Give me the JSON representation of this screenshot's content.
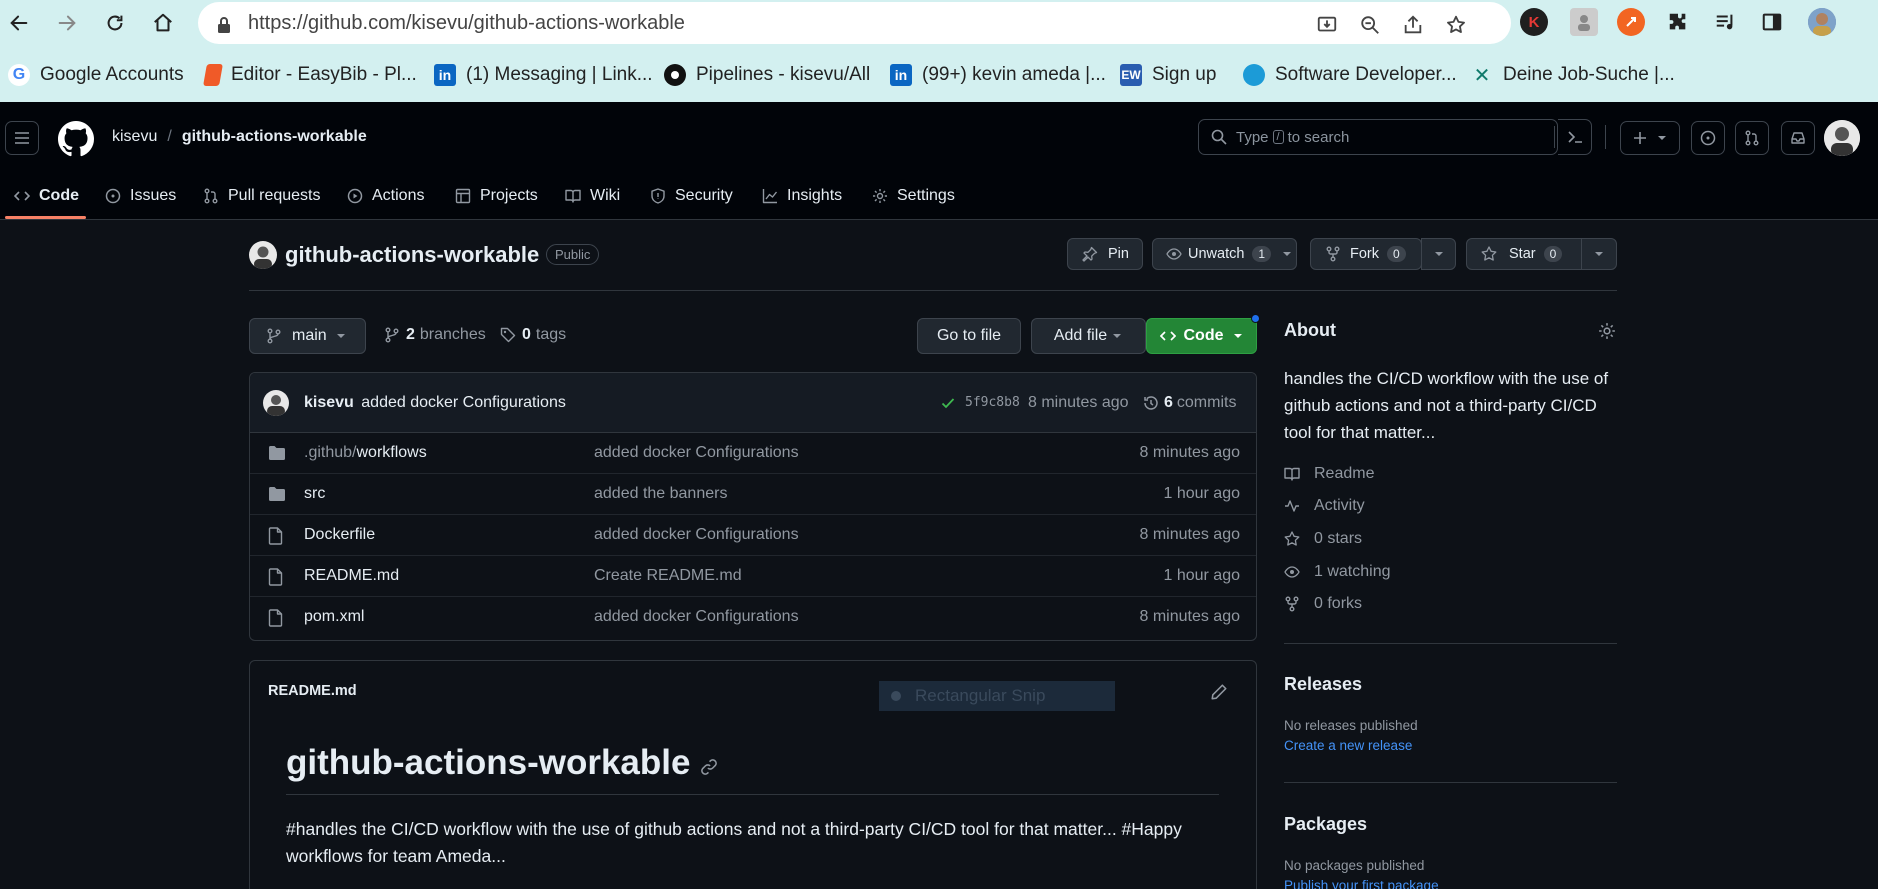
{
  "browser": {
    "url": "https://github.com/kisevu/github-actions-workable",
    "url_host": "https://github.com/",
    "url_path": "kisevu/github-actions-workable",
    "bookmarks": [
      {
        "label": "Google Accounts",
        "icon": "google-icon",
        "color": "#4285f4"
      },
      {
        "label": "Editor - EasyBib - Pl...",
        "icon": "easybib-icon",
        "color": "#f05a28"
      },
      {
        "label": "(1) Messaging | Link...",
        "icon": "linkedin-icon",
        "color": "#0a66c2"
      },
      {
        "label": "Pipelines - kisevu/All",
        "icon": "circleci-icon",
        "color": "#111111"
      },
      {
        "label": "(99+) kevin ameda |...",
        "icon": "linkedin-icon",
        "color": "#0a66c2"
      },
      {
        "label": "Sign up",
        "icon": "ew-icon",
        "color": "#2a5db0"
      },
      {
        "label": "Software Developer...",
        "icon": "globe-icon",
        "color": "#1c9bd7"
      },
      {
        "label": "Deine Job-Suche |...",
        "icon": "xing-icon",
        "color": "#0f7a6b"
      }
    ]
  },
  "header": {
    "owner": "kisevu",
    "separator": "/",
    "repo": "github-actions-workable",
    "search_prefix": "Type",
    "search_key": "/",
    "search_suffix": "to search"
  },
  "tabs": [
    {
      "label": "Code",
      "icon": "code-icon"
    },
    {
      "label": "Issues",
      "icon": "issue-icon"
    },
    {
      "label": "Pull requests",
      "icon": "pull-request-icon"
    },
    {
      "label": "Actions",
      "icon": "play-icon"
    },
    {
      "label": "Projects",
      "icon": "table-icon"
    },
    {
      "label": "Wiki",
      "icon": "book-icon"
    },
    {
      "label": "Security",
      "icon": "shield-icon"
    },
    {
      "label": "Insights",
      "icon": "graph-icon"
    },
    {
      "label": "Settings",
      "icon": "gear-icon"
    }
  ],
  "repo_head": {
    "name": "github-actions-workable",
    "visibility": "Public",
    "pin": "Pin",
    "unwatch": "Unwatch",
    "unwatch_count": "1",
    "fork": "Fork",
    "fork_count": "0",
    "star": "Star",
    "star_count": "0"
  },
  "toolbar": {
    "branch": "main",
    "branches_count": "2",
    "branches_label": "branches",
    "tags_count": "0",
    "tags_label": "tags",
    "go_to_file": "Go to file",
    "add_file": "Add file",
    "code": "Code"
  },
  "latest_commit": {
    "author": "kisevu",
    "message": "added docker Configurations",
    "sha": "5f9c8b8",
    "time": "8 minutes ago",
    "commits_count": "6",
    "commits_label": "commits"
  },
  "files": [
    {
      "type": "folder",
      "prefix": ".github/",
      "name": "workflows",
      "message": "added docker Configurations",
      "time": "8 minutes ago"
    },
    {
      "type": "folder",
      "prefix": "",
      "name": "src",
      "message": "added the banners",
      "time": "1 hour ago"
    },
    {
      "type": "file",
      "prefix": "",
      "name": "Dockerfile",
      "message": "added docker Configurations",
      "time": "8 minutes ago"
    },
    {
      "type": "file",
      "prefix": "",
      "name": "README.md",
      "message": "Create README.md",
      "time": "1 hour ago"
    },
    {
      "type": "file",
      "prefix": "",
      "name": "pom.xml",
      "message": "added docker Configurations",
      "time": "8 minutes ago"
    }
  ],
  "readme": {
    "filename": "README.md",
    "heading": "github-actions-workable",
    "body": "#handles the CI/CD workflow with the use of github actions and not a third-party CI/CD tool for that matter... #Happy workflows for team Ameda...",
    "overlay_text": "Rectangular Snip"
  },
  "about": {
    "title": "About",
    "description": "handles the CI/CD workflow with the use of github actions and not a third-party CI/CD tool for that matter...",
    "items": [
      {
        "label": "Readme",
        "icon": "book-icon"
      },
      {
        "label": "Activity",
        "icon": "pulse-icon"
      },
      {
        "label": "0 stars",
        "icon": "star-icon"
      },
      {
        "label": "1 watching",
        "icon": "eye-icon"
      },
      {
        "label": "0 forks",
        "icon": "fork-icon"
      }
    ]
  },
  "releases": {
    "title": "Releases",
    "empty": "No releases published",
    "link": "Create a new release"
  },
  "packages": {
    "title": "Packages",
    "empty": "No packages published",
    "link": "Publish your first package"
  },
  "colors": {
    "accent_green": "#238636",
    "link_blue": "#4493f8",
    "tab_underline": "#f78166",
    "background": "#0d1117",
    "chrome_bar": "#d3f0f0"
  }
}
